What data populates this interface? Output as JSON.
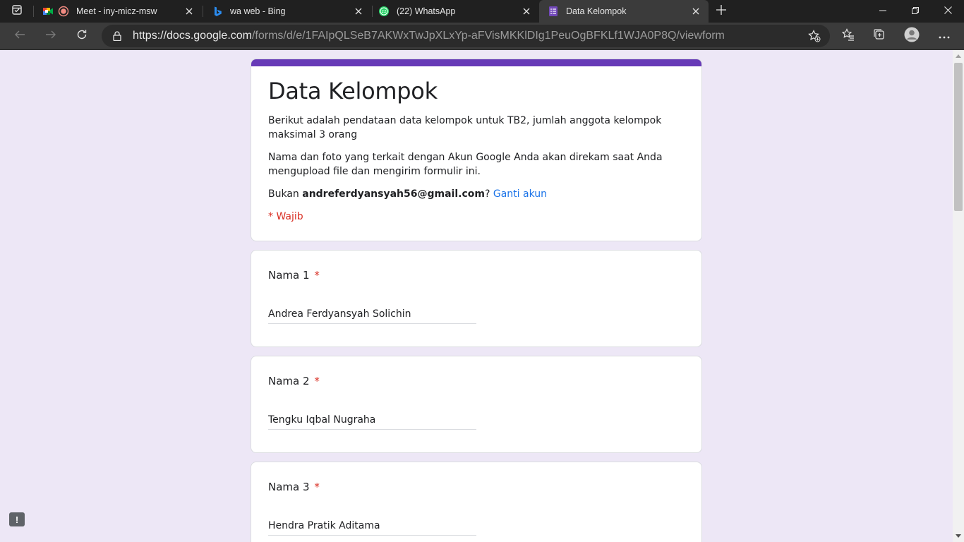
{
  "browser": {
    "tabs": [
      {
        "title": "Meet - iny-micz-msw",
        "favicon": "google-meet-icon",
        "recording": true
      },
      {
        "title": "wa web - Bing",
        "favicon": "bing-icon"
      },
      {
        "title": "(22) WhatsApp",
        "favicon": "whatsapp-icon",
        "badge": "22"
      },
      {
        "title": "Data Kelompok",
        "favicon": "google-forms-icon",
        "active": true
      }
    ],
    "url_host": "https://docs.google.com",
    "url_path": "/forms/d/e/1FAIpQLSeB7AKWxTwJpXLxYp-aFVisMKKlDIg1PeuOgBFKLf1WJA0P8Q/viewform"
  },
  "form": {
    "title": "Data Kelompok",
    "description": "Berikut adalah pendataan data kelompok untuk TB2, jumlah anggota kelompok maksimal 3 orang",
    "notice": "Nama dan foto yang terkait dengan Akun Google Anda akan direkam saat Anda mengupload file dan mengirim formulir ini.",
    "account_prefix": "Bukan ",
    "account_email": "andreferdyansyah56@gmail.com",
    "account_suffix": "? ",
    "switch_account": "Ganti akun",
    "required_note": "* Wajib",
    "questions": [
      {
        "label": "Nama 1",
        "required_mark": "*",
        "answer": "Andrea Ferdyansyah Solichin"
      },
      {
        "label": "Nama 2",
        "required_mark": "*",
        "answer": "Tengku Iqbal Nugraha"
      },
      {
        "label": "Nama 3",
        "required_mark": "*",
        "answer": "Hendra Pratik Aditama"
      }
    ],
    "feedback_glyph": "!"
  },
  "colors": {
    "accent": "#673ab7",
    "page_bg": "#ede7f6",
    "required": "#d93025",
    "link": "#1a73e8"
  }
}
